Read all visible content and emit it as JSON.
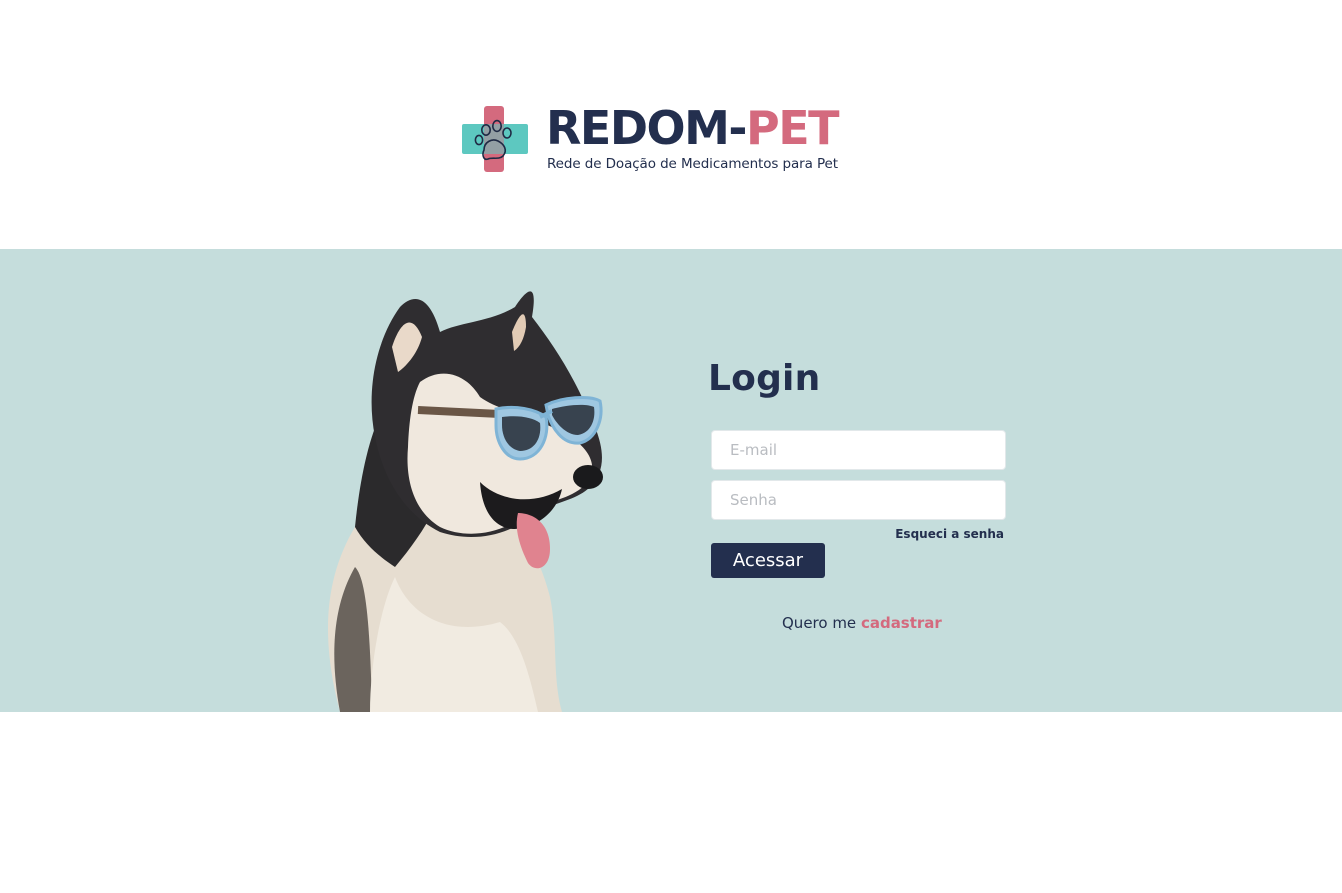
{
  "brand": {
    "name_part1": "REDOM-",
    "name_part2": "PET",
    "tagline": "Rede de Doação de Medicamentos para Pet",
    "colors": {
      "navy": "#232f4e",
      "pink": "#d46a7e",
      "teal": "#5dc8c0",
      "band": "#c5dddc"
    }
  },
  "hero": {
    "image": "husky-with-sunglasses"
  },
  "login": {
    "title": "Login",
    "email_placeholder": "E-mail",
    "password_placeholder": "Senha",
    "forgot_label": "Esqueci a senha",
    "submit_label": "Acessar",
    "signup_prefix": "Quero me ",
    "signup_link": "cadastrar"
  }
}
